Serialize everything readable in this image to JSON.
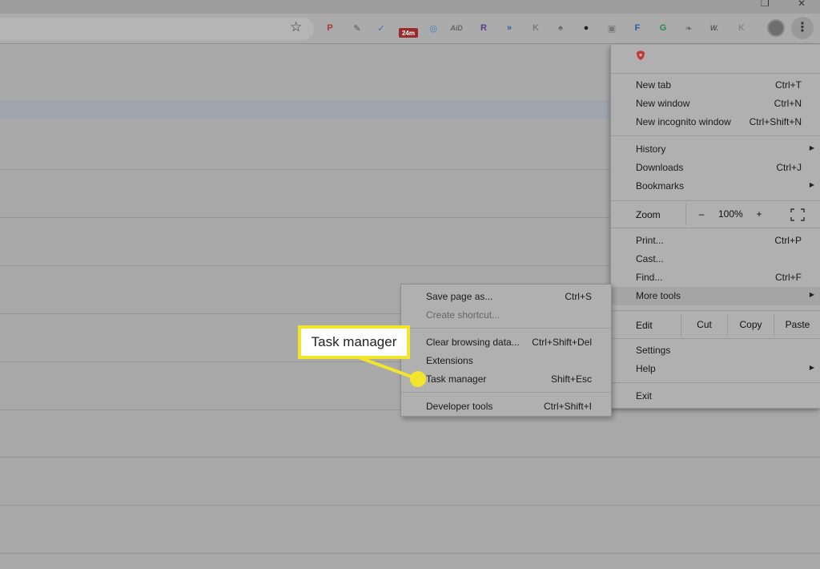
{
  "window": {
    "controls": [
      "❐",
      "✕"
    ]
  },
  "toolbar": {
    "extensions": [
      {
        "name": "pinterest-icon",
        "glyph": "P",
        "color": "#b03030"
      },
      {
        "name": "eyedropper-icon",
        "glyph": "✎",
        "color": "#555555"
      },
      {
        "name": "shield-check-icon",
        "glyph": "✓",
        "color": "#2f6fa8"
      },
      {
        "name": "timer-badge-icon",
        "glyph": "24m",
        "color": "#9b2a2a"
      },
      {
        "name": "compass-icon",
        "glyph": "◎",
        "color": "#3b7fb4"
      },
      {
        "name": "aid-icon",
        "glyph": "AiD",
        "color": "#666666"
      },
      {
        "name": "r-extension-icon",
        "glyph": "R",
        "color": "#5a3a8a"
      },
      {
        "name": "arrows-icon",
        "glyph": "»",
        "color": "#2b5fa8"
      },
      {
        "name": "hootsuite-icon",
        "glyph": "K",
        "color": "#7a7a7a"
      },
      {
        "name": "acorn-icon",
        "glyph": "♠",
        "color": "#6a6a6a"
      },
      {
        "name": "owl-icon",
        "glyph": "●",
        "color": "#222222"
      },
      {
        "name": "clipboard-icon",
        "glyph": "▣",
        "color": "#777777"
      },
      {
        "name": "feedly-icon",
        "glyph": "F",
        "color": "#2a5aa8"
      },
      {
        "name": "grammarly-icon",
        "glyph": "G",
        "color": "#2a8a4a"
      },
      {
        "name": "leaf-icon",
        "glyph": "❧",
        "color": "#6a6a6a"
      },
      {
        "name": "wordtune-icon",
        "glyph": "W.",
        "color": "#555555"
      },
      {
        "name": "kr-icon",
        "glyph": "K",
        "color": "#888888"
      }
    ],
    "menu_glyph": "⋮",
    "star_glyph": "☆"
  },
  "main_menu": {
    "new_tab": {
      "label": "New tab",
      "shortcut": "Ctrl+T"
    },
    "new_window": {
      "label": "New window",
      "shortcut": "Ctrl+N"
    },
    "new_incognito": {
      "label": "New incognito window",
      "shortcut": "Ctrl+Shift+N"
    },
    "history": {
      "label": "History"
    },
    "downloads": {
      "label": "Downloads",
      "shortcut": "Ctrl+J"
    },
    "bookmarks": {
      "label": "Bookmarks"
    },
    "zoom": {
      "label": "Zoom",
      "minus": "–",
      "value": "100%",
      "plus": "+"
    },
    "print": {
      "label": "Print...",
      "shortcut": "Ctrl+P"
    },
    "cast": {
      "label": "Cast..."
    },
    "find": {
      "label": "Find...",
      "shortcut": "Ctrl+F"
    },
    "more_tools": {
      "label": "More tools"
    },
    "edit": {
      "label": "Edit",
      "cut": "Cut",
      "copy": "Copy",
      "paste": "Paste"
    },
    "settings": {
      "label": "Settings"
    },
    "help": {
      "label": "Help"
    },
    "exit": {
      "label": "Exit"
    },
    "arrow_glyph": "▶"
  },
  "more_tools_menu": {
    "save_page": {
      "label": "Save page as...",
      "shortcut": "Ctrl+S"
    },
    "create_shortcut": {
      "label": "Create shortcut..."
    },
    "clear_browsing": {
      "label": "Clear browsing data...",
      "shortcut": "Ctrl+Shift+Del"
    },
    "extensions": {
      "label": "Extensions"
    },
    "task_manager": {
      "label": "Task manager",
      "shortcut": "Shift+Esc"
    },
    "developer_tools": {
      "label": "Developer tools",
      "shortcut": "Ctrl+Shift+I"
    }
  },
  "callout": {
    "label": "Task manager",
    "color": "#f2e52c"
  }
}
